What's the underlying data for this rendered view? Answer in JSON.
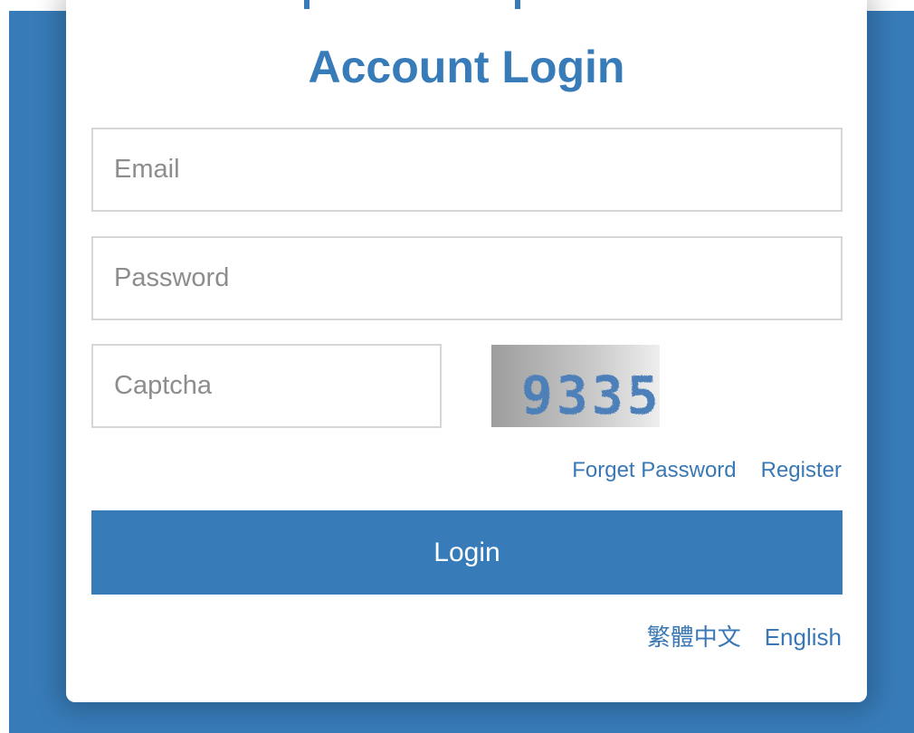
{
  "colors": {
    "primary": "#377bb8",
    "link": "#3a78b5",
    "field_border": "#d6d6d6",
    "placeholder": "#8d8d8d",
    "card_background": "#ffffff"
  },
  "login": {
    "title": "Account Login",
    "email_placeholder": "Email",
    "password_placeholder": "Password",
    "captcha_placeholder": "Captcha",
    "captcha_code": "9335",
    "forget_password_label": "Forget Password",
    "register_label": "Register",
    "login_button_label": "Login"
  },
  "languages": [
    "繁體中文",
    "English"
  ]
}
